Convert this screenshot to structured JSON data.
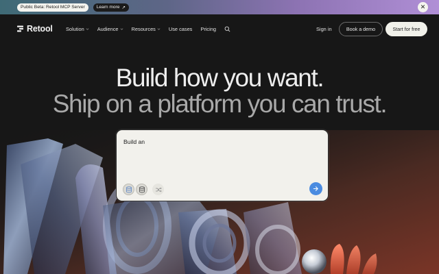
{
  "banner": {
    "beta_label": "Public Beta: Retool MCP Server",
    "learn_label": "Learn more",
    "learn_arrow": "↗",
    "close_glyph": "✕"
  },
  "nav": {
    "logo_text": "Retool",
    "links": [
      {
        "label": "Solution",
        "has_dropdown": true
      },
      {
        "label": "Audience",
        "has_dropdown": true
      },
      {
        "label": "Resources",
        "has_dropdown": true
      },
      {
        "label": "Use cases",
        "has_dropdown": false
      },
      {
        "label": "Pricing",
        "has_dropdown": false
      }
    ],
    "sign_in": "Sign in",
    "demo_button": "Book a demo",
    "start_button": "Start for free"
  },
  "hero": {
    "headline_line1": "Build how you want.",
    "headline_line2": "Ship on a platform you can trust."
  },
  "prompt": {
    "text": "Build an",
    "tools": [
      "database-icon",
      "database-alt-icon",
      "shuffle-icon"
    ],
    "send_icon": "arrow-right-icon"
  },
  "colors": {
    "background": "#171717",
    "banner_gradient": [
      "#3f6a76",
      "#8d73b3",
      "#b08fd6"
    ],
    "send_button": "#4a8be0",
    "card": "#f2f1ec"
  }
}
